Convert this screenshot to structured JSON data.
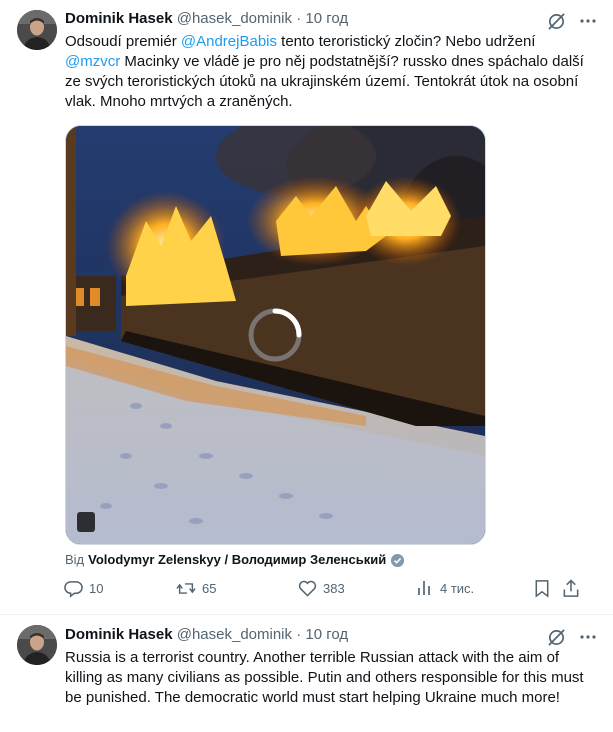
{
  "tweets": [
    {
      "author_name": "Dominik Hasek",
      "handle": "@hasek_dominik",
      "separator": "·",
      "time": "10 год",
      "text_parts": [
        "Odsoudí premiér ",
        "@AndrejBabis",
        " tento teroristický zločin? Nebo udržení\n",
        "@mzvcr",
        " Macinky ve vládě je pro něj podstatnější? russko dnes spáchalo další ze svých teroristických útoků na ukrajinském území. Tentokrát útok na osobní vlak. Mnoho mrtvých a zraněných."
      ],
      "source_prefix": "Від",
      "source_name": "Volodymyr Zelenskyy / Володимир Зеленський",
      "metrics": {
        "replies": "10",
        "reposts": "65",
        "likes": "383",
        "views": "4 тис."
      }
    },
    {
      "author_name": "Dominik Hasek",
      "handle": "@hasek_dominik",
      "separator": "·",
      "time": "10 год",
      "text": "Russia is a terrorist country. Another terrible Russian attack with the aim of killing as many civilians as possible. Putin and others responsible for this must be punished. The democratic world must start helping Ukraine much more!"
    }
  ],
  "icons": {
    "grok": "grok-icon",
    "more": "more-icon",
    "verified": "verified-badge-icon",
    "reply": "reply-icon",
    "repost": "repost-icon",
    "like": "like-icon",
    "views": "views-icon",
    "bookmark": "bookmark-icon",
    "share": "share-icon"
  },
  "colors": {
    "text": "#0f1419",
    "secondary": "#536471",
    "link": "#1d9bf0",
    "border": "#eff3f4"
  }
}
